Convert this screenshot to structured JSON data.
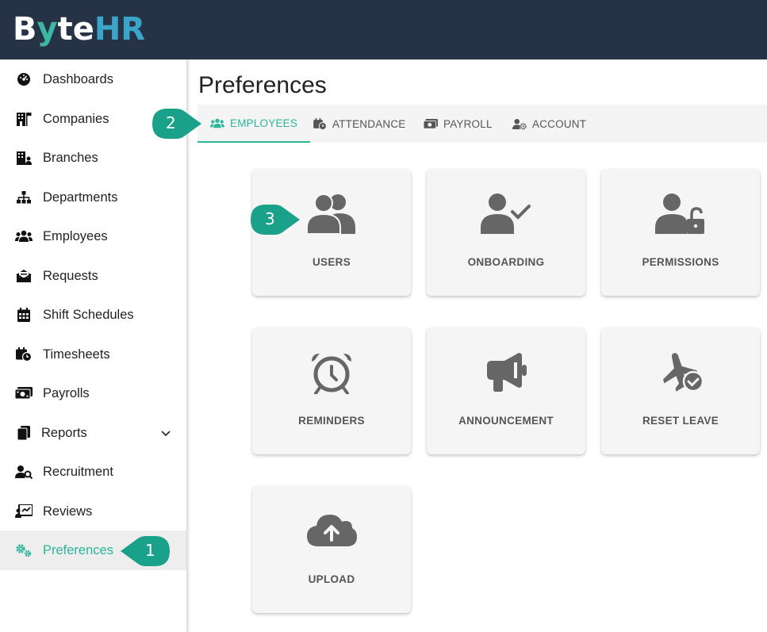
{
  "brand": {
    "b": "B",
    "y": "y",
    "te": "te",
    "hr": "HR"
  },
  "sidebar": {
    "items": [
      {
        "label": "Dashboards",
        "icon": "gauge-icon"
      },
      {
        "label": "Companies",
        "icon": "building-flag-icon"
      },
      {
        "label": "Branches",
        "icon": "building-user-icon"
      },
      {
        "label": "Departments",
        "icon": "sitemap-icon"
      },
      {
        "label": "Employees",
        "icon": "users-icon"
      },
      {
        "label": "Requests",
        "icon": "envelope-open-icon"
      },
      {
        "label": "Shift Schedules",
        "icon": "calendar-icon"
      },
      {
        "label": "Timesheets",
        "icon": "calendar-clock-icon"
      },
      {
        "label": "Payrolls",
        "icon": "money-bill-icon"
      },
      {
        "label": "Reports",
        "icon": "file-icon"
      },
      {
        "label": "Recruitment",
        "icon": "user-search-icon"
      },
      {
        "label": "Reviews",
        "icon": "chart-board-icon"
      },
      {
        "label": "Preferences",
        "icon": "gears-icon",
        "active": true
      }
    ]
  },
  "page": {
    "title": "Preferences"
  },
  "tabs": [
    {
      "label": "EMPLOYEES",
      "icon": "users-icon",
      "active": true
    },
    {
      "label": "ATTENDANCE",
      "icon": "calendar-clock-icon"
    },
    {
      "label": "PAYROLL",
      "icon": "money-bill-icon"
    },
    {
      "label": "ACCOUNT",
      "icon": "user-gear-icon"
    }
  ],
  "cards": [
    {
      "label": "USERS",
      "icon": "users-icon"
    },
    {
      "label": "ONBOARDING",
      "icon": "user-check-icon"
    },
    {
      "label": "PERMISSIONS",
      "icon": "user-lock-icon"
    },
    {
      "label": "REMINDERS",
      "icon": "alarm-clock-icon"
    },
    {
      "label": "ANNOUNCEMENT",
      "icon": "bullhorn-icon"
    },
    {
      "label": "RESET LEAVE",
      "icon": "plane-check-icon"
    },
    {
      "label": "UPLOAD",
      "icon": "cloud-upload-icon"
    }
  ],
  "markers": [
    "1",
    "2",
    "3"
  ],
  "colors": {
    "accent": "#2bb59a",
    "topbar": "#263245",
    "marker": "#1aa189",
    "icon": "#666666"
  }
}
